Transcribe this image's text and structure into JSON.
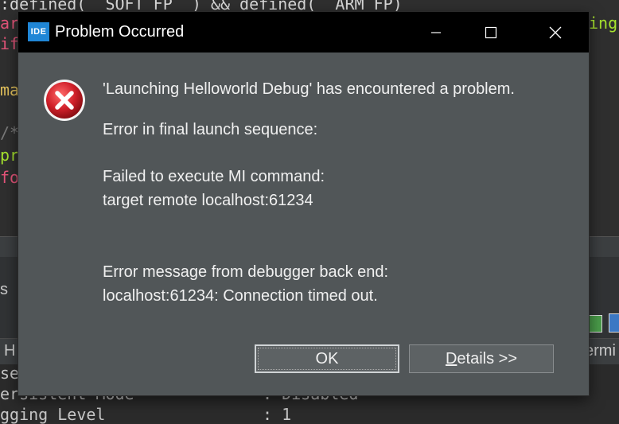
{
  "background": {
    "editor_lines": [
      {
        "text": ":defined(__SOFT_FP__) && defined(__ARM_FP)",
        "color": "#d8d8d8"
      },
      {
        "text": "ar",
        "color": "#e6557a"
      },
      {
        "text": "if",
        "color": "#e6557a"
      },
      {
        "text": "ma",
        "color": "#e2c15c"
      },
      {
        "text": "/*",
        "color": "#7a7a7a"
      },
      {
        "text": "pr",
        "color": "#a6e22e"
      },
      {
        "text": "fo",
        "color": "#e6557a"
      }
    ],
    "editor_right_fragment": "ing",
    "left_tab_fragment": "s",
    "tab_left_fragment": "H",
    "tab_right_fragment": "ermi",
    "console_lines": [
      {
        "label": "ser",
        "value": ""
      },
      {
        "label": "ersistent Mode",
        "value": ": Disabled"
      },
      {
        "label": "gging Level",
        "value": ": 1"
      }
    ]
  },
  "dialog": {
    "app_icon_label": "IDE",
    "title": "Problem Occurred",
    "icons": {
      "app": "ide-icon",
      "error": "error-icon",
      "minimize": "minimize-icon",
      "maximize": "maximize-icon",
      "close": "close-icon"
    },
    "header": "'Launching Helloworld Debug' has encountered a problem.",
    "line1": "Error in final launch sequence:",
    "line2": "Failed to execute MI command:",
    "line3": "target remote localhost:61234",
    "line4": "Error message from debugger back end:",
    "line5": "localhost:61234: Connection timed out.",
    "ok_label": "OK",
    "details_mnemonic": "D",
    "details_rest": "etails >>",
    "colors": {
      "dialog_bg": "#515658",
      "titlebar": "#000000",
      "error_red": "#d0202a",
      "accent": "#1f86d6"
    }
  }
}
